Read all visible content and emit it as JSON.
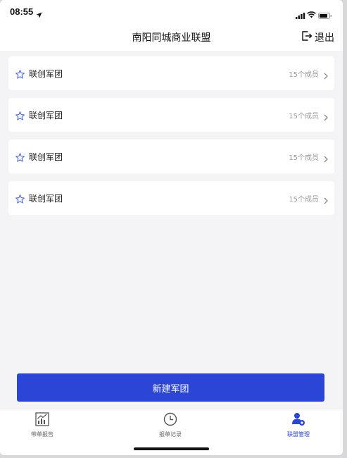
{
  "status_bar": {
    "time": "08:55"
  },
  "nav": {
    "title": "南阳同城商业联盟",
    "logout_label": "退出"
  },
  "groups": [
    {
      "name": "联创军团",
      "count": "15个成员"
    },
    {
      "name": "联创军团",
      "count": "15个成员"
    },
    {
      "name": "联创军团",
      "count": "15个成员"
    },
    {
      "name": "联创军团",
      "count": "15个成员"
    }
  ],
  "create_button_label": "新建军团",
  "tabs": [
    {
      "label": "带单报告",
      "icon": "chart-report-icon"
    },
    {
      "label": "报单记录",
      "icon": "clock-icon"
    },
    {
      "label": "联盟管理",
      "icon": "user-settings-icon",
      "active": true
    }
  ],
  "colors": {
    "accent": "#2b46d6",
    "background": "#f4f4f6",
    "muted_text": "#9a9aa0"
  }
}
